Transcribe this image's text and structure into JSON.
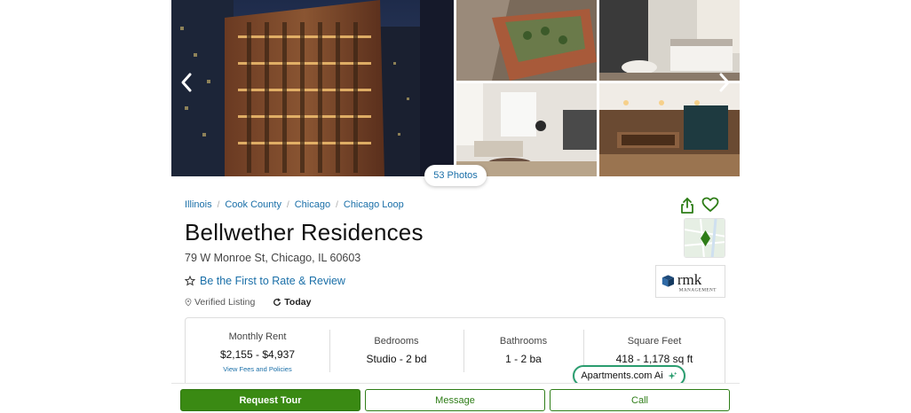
{
  "gallery": {
    "photo_count_label": "53 Photos",
    "prev_icon": "chevron-left-icon",
    "next_icon": "chevron-right-icon"
  },
  "breadcrumb": [
    "Illinois",
    "Cook County",
    "Chicago",
    "Chicago Loop"
  ],
  "listing": {
    "name": "Bellwether Residences",
    "address": "79 W Monroe St, Chicago, IL 60603",
    "review_link": "Be the First to Rate & Review",
    "verified_label": "Verified Listing",
    "updated_label": "Today"
  },
  "logo": {
    "text": "rmk",
    "subtext": "MANAGEMENT"
  },
  "stats": {
    "rent_label": "Monthly Rent",
    "rent_value": "$2,155 - $4,937",
    "fees_link": "View Fees and Policies",
    "bedrooms_label": "Bedrooms",
    "bedrooms_value": "Studio - 2 bd",
    "bathrooms_label": "Bathrooms",
    "bathrooms_value": "1 - 2 ba",
    "sqft_label": "Square Feet",
    "sqft_value": "418 - 1,178 sq ft"
  },
  "ai_assistant": {
    "label": "Apartments.com Ai",
    "icon": "sparkle-icon"
  },
  "actions": {
    "request_tour": "Request Tour",
    "message": "Message",
    "call": "Call"
  },
  "colors": {
    "link": "#1a6fa8",
    "primary_green": "#3a8a13",
    "ai_border": "#2a9d6f"
  }
}
